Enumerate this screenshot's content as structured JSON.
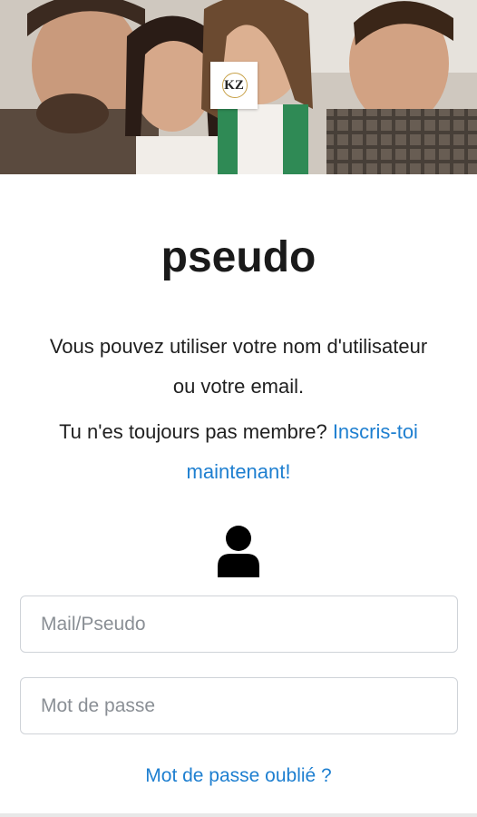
{
  "hero": {
    "image_alt": "group of smiling young people",
    "logo_text": "KZ"
  },
  "main": {
    "title": "pseudo",
    "info_line_1": "Vous pouvez utiliser votre nom d'utilisateur",
    "info_line_2": "ou votre email.",
    "signup_prompt": "Tu n'es toujours pas membre? ",
    "signup_link": "Inscris-toi maintenant!",
    "user_icon": "user-icon"
  },
  "form": {
    "mail_placeholder": "Mail/Pseudo",
    "mail_value": "",
    "password_placeholder": "Mot de passe",
    "password_value": "",
    "forgot_link": "Mot de passe oublié ?"
  },
  "colors": {
    "link": "#1e7fd0",
    "title": "#1a1a1a",
    "field_border": "#cfd3d8"
  }
}
